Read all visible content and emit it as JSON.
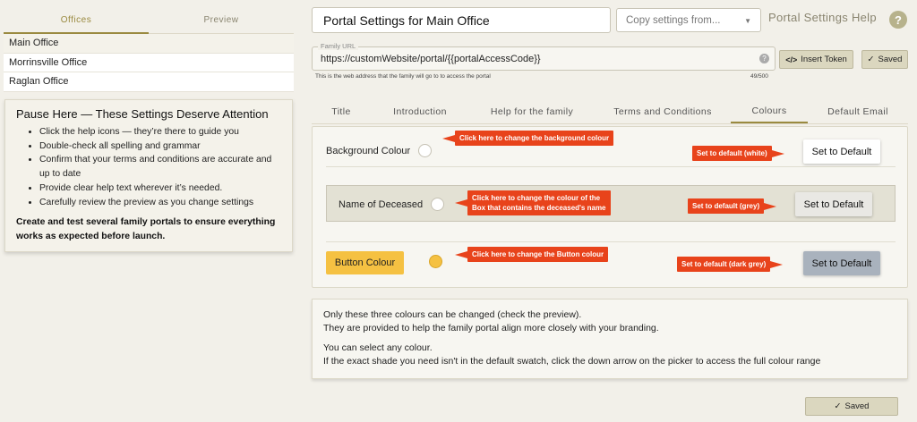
{
  "left_tabs": [
    "Offices",
    "Preview"
  ],
  "offices": [
    "Main Office",
    "Morrinsville Office",
    "Raglan Office"
  ],
  "attention": {
    "title": "Pause Here — These Settings Deserve Attention",
    "items": [
      "Click the help icons — they’re there to guide you",
      "Double-check all spelling and grammar",
      "Confirm that your terms and conditions are accurate and up to date",
      "Provide clear help text wherever it’s needed.",
      "Carefully review the preview as you change settings"
    ],
    "footer": "Create and test several family portals to ensure everything works as expected before launch."
  },
  "header": {
    "title": "Portal Settings for Main Office",
    "copy_placeholder": "Copy settings from...",
    "help_title": "Portal Settings Help",
    "help_icon": "?"
  },
  "url": {
    "legend": "Family URL",
    "value": "https://customWebsite/portal/{{portalAccessCode}}",
    "hint": "This is the web address that the family will go to to access the portal",
    "count": "49/500",
    "help_icon": "?",
    "token_icon": "</>",
    "insert_token": "Insert Token",
    "saved_icon": "✓",
    "saved": "Saved"
  },
  "tabs": [
    "Title",
    "Introduction",
    "Help for the family",
    "Terms and Conditions",
    "Colours",
    "Default Email"
  ],
  "colours": {
    "background": {
      "label": "Background Colour",
      "swatch": "#ffffff",
      "callout": "Click here to change the background colour",
      "default_callout": "Set to default (white)",
      "default_button": "Set to Default"
    },
    "deceased": {
      "label": "Name of Deceased",
      "swatch": "#ffffff",
      "callout_line1": "Click here to change the colour of the",
      "callout_line2": "Box that contains the deceased's name",
      "default_callout": "Set to default (grey)",
      "default_button": "Set to Default"
    },
    "button": {
      "label": "Button Colour",
      "swatch": "#f5c142",
      "callout": "Click here to change the Button colour",
      "default_callout": "Set to default (dark grey)",
      "default_button": "Set to Default"
    }
  },
  "info": {
    "line1": "Only these three colours can be changed (check the preview).",
    "line2": "They are provided to help the family portal align more closely with your branding.",
    "line3": "You can select any colour.",
    "line4": "If the exact shade you need isn't in the default swatch, click the down arrow on the picker to access the full colour range"
  },
  "bottom": {
    "saved_icon": "✓",
    "saved": "Saved"
  },
  "accent": "#e8431b"
}
